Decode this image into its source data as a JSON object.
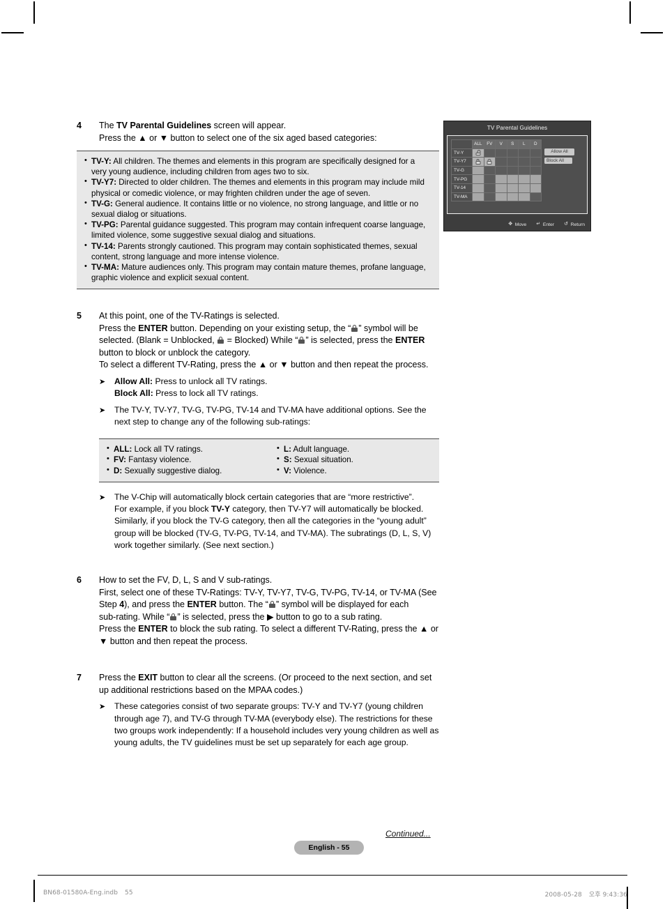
{
  "steps": [
    {
      "num": "4",
      "lines": [
        {
          "segments": [
            {
              "t": "The ",
              "b": false
            },
            {
              "t": "TV Parental Guidelines",
              "b": true
            },
            {
              "t": " screen will appear.",
              "b": false
            }
          ]
        },
        {
          "segments": [
            {
              "t": "Press the ▲ or ▼ button to select one of the six aged based categories:",
              "b": false
            }
          ]
        }
      ]
    },
    {
      "num": "5",
      "lines": [
        {
          "segments": [
            {
              "t": "At this point, one of the TV-Ratings is selected.",
              "b": false
            }
          ]
        },
        {
          "segments": [
            {
              "t": "Press the ",
              "b": false
            },
            {
              "t": "ENTER",
              "b": true
            },
            {
              "t": " button. Depending on your existing setup, the “",
              "b": false
            },
            {
              "t": "[LOCK]",
              "b": false
            },
            {
              "t": "” symbol will be selected. (Blank = Unblocked, ",
              "b": false
            },
            {
              "t": "[LOCK]",
              "b": false
            },
            {
              "t": " = Blocked) While “",
              "b": false
            },
            {
              "t": "[LOCK]",
              "b": false
            },
            {
              "t": "” is selected, press the ",
              "b": false
            },
            {
              "t": "ENTER",
              "b": true
            },
            {
              "t": " button to block or unblock the category.",
              "b": false
            }
          ]
        },
        {
          "segments": [
            {
              "t": "To select a different TV-Rating, press the ▲ or ▼ button and then repeat the process.",
              "b": false
            }
          ]
        }
      ]
    },
    {
      "num": "6",
      "lines": [
        {
          "segments": [
            {
              "t": "How to set the FV, D, L, S and V sub-ratings.",
              "b": false
            }
          ]
        },
        {
          "segments": [
            {
              "t": "First, select one of these TV-Ratings: TV-Y, TV-Y7, TV-G, TV-PG, TV-14, or TV-MA (See Step ",
              "b": false
            },
            {
              "t": "4",
              "b": true
            },
            {
              "t": "), and press the ",
              "b": false
            },
            {
              "t": "ENTER",
              "b": true
            },
            {
              "t": " button. The “",
              "b": false
            },
            {
              "t": "[LOCK]",
              "b": false
            },
            {
              "t": "” symbol will be displayed for each",
              "b": false
            }
          ]
        },
        {
          "segments": [
            {
              "t": "sub-rating. While “",
              "b": false
            },
            {
              "t": "[LOCK]",
              "b": false
            },
            {
              "t": "” is selected, press the ▶ button to go to a sub rating.",
              "b": false
            }
          ]
        },
        {
          "segments": [
            {
              "t": "Press the ",
              "b": false
            },
            {
              "t": "ENTER",
              "b": true
            },
            {
              "t": " to block the sub rating. To select a different TV-Rating, press the ▲ or ▼ button and then repeat the process.",
              "b": false
            }
          ]
        }
      ]
    },
    {
      "num": "7",
      "lines": [
        {
          "segments": [
            {
              "t": "Press the ",
              "b": false
            },
            {
              "t": "EXIT",
              "b": true
            },
            {
              "t": " button to clear all the screens. (Or proceed to the next section, and set up additional restrictions based on the MPAA codes.)",
              "b": false
            }
          ]
        }
      ]
    }
  ],
  "ratings_box": {
    "items": [
      {
        "term": "TV-Y:",
        "desc": " All children. The themes and elements in this program are specifically designed for a very young audience, including children from ages two to six."
      },
      {
        "term": "TV-Y7:",
        "desc": " Directed to older children. The themes and elements in this program may include mild physical or comedic violence, or may frighten children under the age of seven."
      },
      {
        "term": "TV-G:",
        "desc": " General audience. It contains little or no violence, no strong language, and little or no sexual dialog or situations."
      },
      {
        "term": "TV-PG:",
        "desc": " Parental guidance suggested. This program may contain infrequent coarse language, limited violence, some suggestive sexual dialog and situations."
      },
      {
        "term": "TV-14:",
        "desc": " Parents strongly cautioned. This program may contain sophisticated themes, sexual content, strong language and more intense violence."
      },
      {
        "term": "TV-MA:",
        "desc": " Mature audiences only. This program may contain mature themes, profane language, graphic violence and explicit sexual content."
      }
    ]
  },
  "subrating_box": {
    "left": [
      {
        "term": "ALL:",
        "desc": " Lock all TV ratings."
      },
      {
        "term": "FV:",
        "desc": " Fantasy violence."
      },
      {
        "term": "D:",
        "desc": " Sexually suggestive dialog."
      }
    ],
    "right": [
      {
        "term": "L:",
        "desc": " Adult language."
      },
      {
        "term": "S:",
        "desc": " Sexual situation."
      },
      {
        "term": "V:",
        "desc": " Violence."
      }
    ]
  },
  "notes": {
    "allow_block": {
      "line1_term": "Allow All:",
      "line1_desc": " Press to unlock all TV ratings.",
      "line2_term": "Block All:",
      "line2_desc": " Press to lock all TV ratings."
    },
    "additional_options": "The TV-Y, TV-Y7, TV-G, TV-PG, TV-14 and TV-MA have additional options. See the next step to change any of the following sub-ratings:",
    "vchip_line1": "The V-Chip will automatically block certain categories that are “more restrictive”.",
    "vchip_line2_a": "For example, if you block ",
    "vchip_line2_bold": "TV-Y",
    "vchip_line2_b": " category, then TV-Y7 will automatically be blocked. Similarly, if you block the TV-G category, then all the categories in the “young adult” group will be blocked (TV-G, TV-PG, TV-14, and TV-MA). The subratings (D, L, S, V) work together similarly. (See next section.)",
    "two_groups": "These categories consist of two separate groups: TV-Y and TV-Y7 (young children through age 7), and TV-G through TV-MA (everybody else). The restrictions for these two groups work independently: If a household includes very young children as well as young adults, the TV guidelines must be set up separately for each age group."
  },
  "osd": {
    "title": "TV Parental Guidelines",
    "columns": [
      "ALL",
      "FV",
      "V",
      "S",
      "L",
      "D"
    ],
    "rows": [
      {
        "label": "TV-Y",
        "cells": [
          "lock-open",
          "off",
          "off",
          "off",
          "off",
          "off"
        ]
      },
      {
        "label": "TV-Y7",
        "cells": [
          "lock",
          "lock",
          "off",
          "off",
          "off",
          "off"
        ]
      },
      {
        "label": "TV-G",
        "cells": [
          "on",
          "off",
          "off",
          "off",
          "off",
          "off"
        ]
      },
      {
        "label": "TV-PG",
        "cells": [
          "on",
          "off",
          "on",
          "on",
          "on",
          "on"
        ]
      },
      {
        "label": "TV-14",
        "cells": [
          "on",
          "off",
          "on",
          "on",
          "on",
          "on"
        ]
      },
      {
        "label": "TV-MA",
        "cells": [
          "on",
          "off",
          "on",
          "on",
          "on",
          "off"
        ]
      }
    ],
    "buttons": {
      "allow_all": "Allow All",
      "block_all": "Block All"
    },
    "footer": [
      {
        "icon": "dpad-icon",
        "glyph": "✥",
        "label": "Move"
      },
      {
        "icon": "enter-icon",
        "glyph": "↵",
        "label": "Enter"
      },
      {
        "icon": "return-icon",
        "glyph": "↺",
        "label": "Return"
      }
    ]
  },
  "footer": {
    "page_label": "English - 55",
    "continued": "Continued...",
    "file_name": "BN68-01580A-Eng.indb",
    "file_page": "55",
    "timestamp_date": "2008-05-28",
    "timestamp_time": "오후 9:43:36"
  },
  "colors": {
    "graybox_bg": "#e8e8e8",
    "osd_bg": "#3d3d3d",
    "badge_bg": "#b3b3b3"
  }
}
